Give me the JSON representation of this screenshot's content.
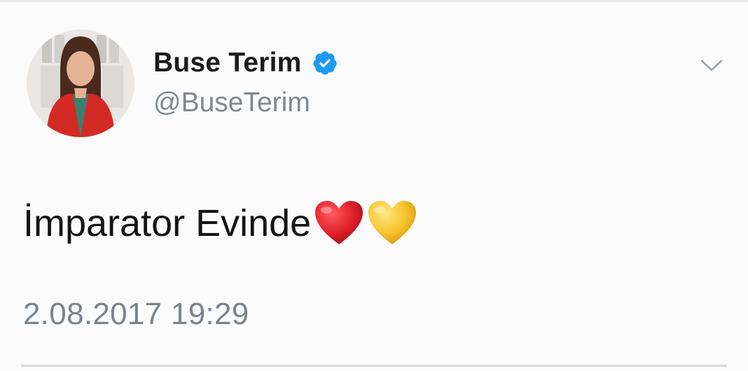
{
  "tweet": {
    "display_name": "Buse Terim",
    "handle": "@BuseTerim",
    "verified": true,
    "text": "İmparator Evinde",
    "emojis": [
      "red-heart",
      "yellow-heart"
    ],
    "timestamp": "2.08.2017 19:29"
  },
  "colors": {
    "verified_badge": "#1d9bf0",
    "name_text": "#1b1b1b",
    "secondary_text": "#7f8790",
    "red_heart": "#e0202a",
    "yellow_heart": "#f7c22c"
  }
}
